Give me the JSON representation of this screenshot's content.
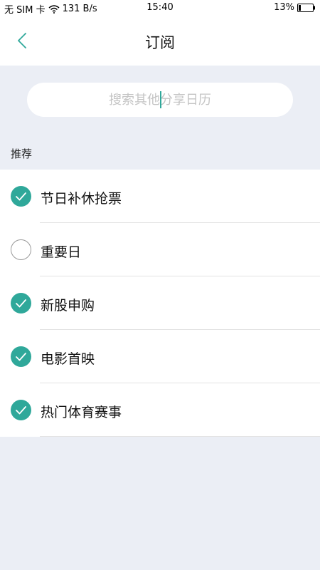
{
  "status_bar": {
    "carrier": "无 SIM 卡",
    "speed": "131 B/s",
    "time": "15:40",
    "battery": "13%"
  },
  "header": {
    "title": "订阅",
    "back_icon": "chevron-left-icon"
  },
  "search": {
    "placeholder": "搜索其他分享日历",
    "value": ""
  },
  "section": {
    "label": "推荐"
  },
  "colors": {
    "accent": "#2fa89a",
    "background": "#ebeef5"
  },
  "items": [
    {
      "label": "节日补休抢票",
      "checked": true
    },
    {
      "label": "重要日",
      "checked": false
    },
    {
      "label": "新股申购",
      "checked": true
    },
    {
      "label": "电影首映",
      "checked": true
    },
    {
      "label": "热门体育赛事",
      "checked": true
    }
  ]
}
